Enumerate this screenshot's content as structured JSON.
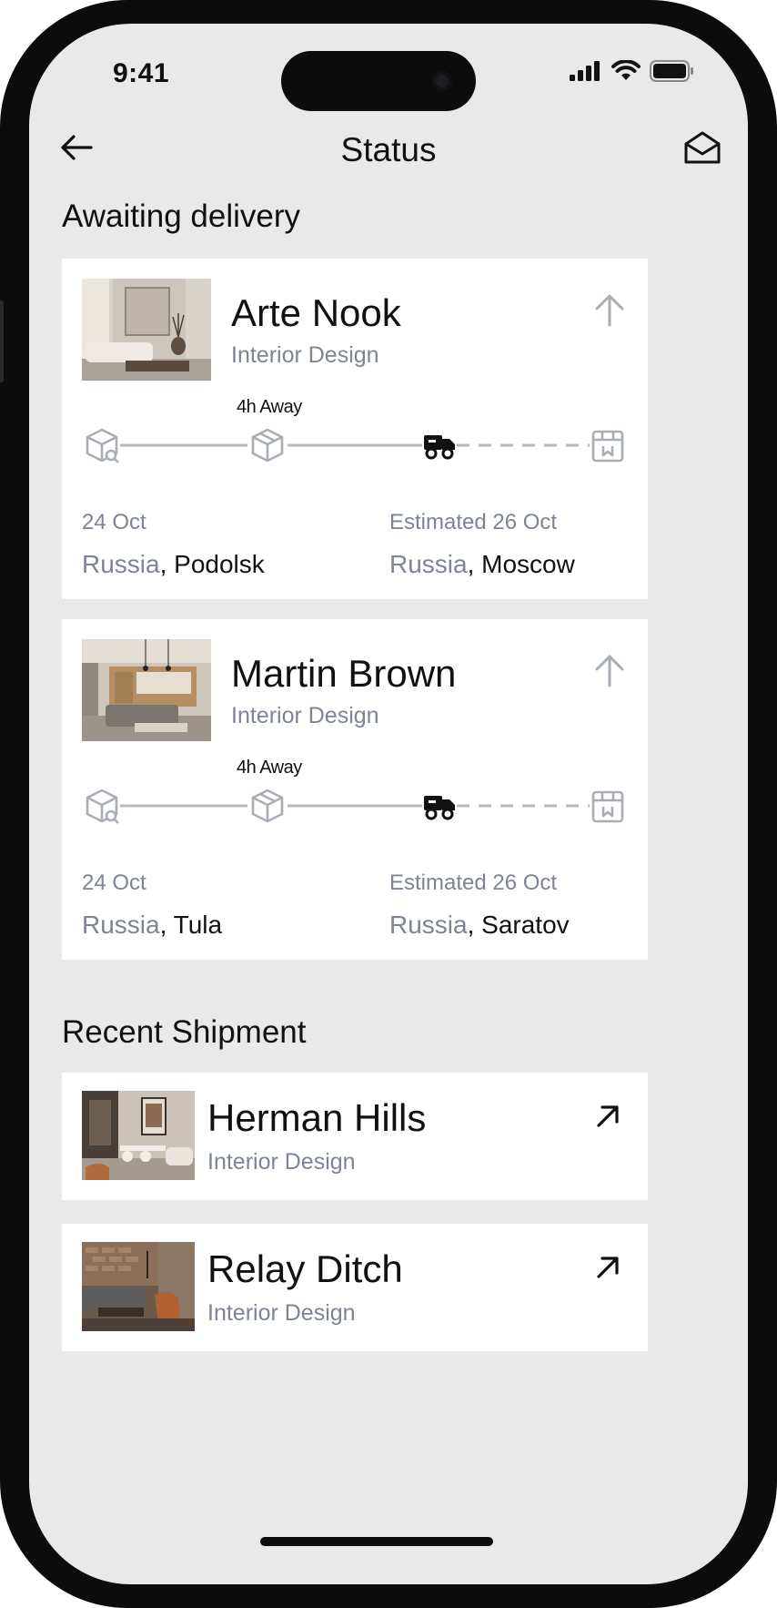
{
  "status_bar": {
    "time": "9:41"
  },
  "nav": {
    "title": "Status",
    "back_icon": "arrow-left-icon",
    "mail_icon": "envelope-open-icon"
  },
  "awaiting": {
    "title": "Awaiting delivery",
    "cards": [
      {
        "name": "Arte Nook",
        "subtitle": "Interior Design",
        "away": "4h Away",
        "from_date": "24 Oct",
        "from_country": "Russia",
        "from_city": ", Podolsk",
        "to_date": "Estimated 26 Oct",
        "to_country": "Russia",
        "to_city": ", Moscow"
      },
      {
        "name": "Martin Brown",
        "subtitle": "Interior Design",
        "away": "4h Away",
        "from_date": "24 Oct",
        "from_country": "Russia",
        "from_city": ", Tula",
        "to_date": "Estimated 26 Oct",
        "to_country": "Russia",
        "to_city": ", Saratov"
      }
    ]
  },
  "recent": {
    "title": "Recent Shipment",
    "items": [
      {
        "name": "Herman Hills",
        "subtitle": "Interior Design"
      },
      {
        "name": "Relay Ditch",
        "subtitle": "Interior Design"
      }
    ]
  },
  "colors": {
    "background": "#e9e9e9",
    "card": "#ffffff",
    "muted": "#7d8493",
    "icon_muted": "#a9adb6",
    "text": "#111111"
  }
}
